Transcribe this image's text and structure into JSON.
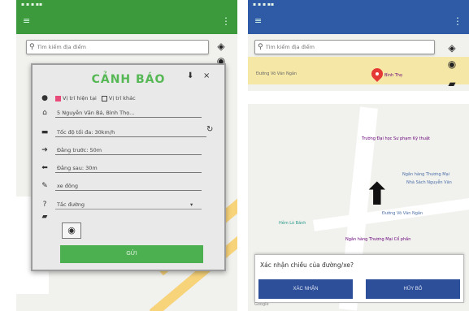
{
  "left_screen": {
    "status_bar": "▪ ▪ ▪  ▪▪",
    "search_placeholder": "Tìm kiếm địa điểm",
    "dialog": {
      "title": "CẢNH BÁO",
      "close_glyph": "×",
      "checkbox_current": "Vị trí hiện tại",
      "checkbox_other": "Vị trí khác",
      "address": "5 Nguyễn Văn Bá, Bình Thọ...",
      "max_speed": "Tốc độ tối đa: 30km/h",
      "before": "Đằng trước: 50m",
      "after": "Đằng sau: 30m",
      "type": "xe đông",
      "category": "Tắc đường",
      "dropdown_glyph": "▾",
      "send_label": "GỬI"
    },
    "icons": {
      "hamburger": "menu-icon",
      "search": "search-icon",
      "layers": "layers-icon"
    },
    "colors": {
      "header": "#3c9a3c",
      "title": "#55b855",
      "send": "#4caf50"
    }
  },
  "right_screen": {
    "status_bar": "▪ ▪ ▪  ▪▪",
    "search_placeholder": "Tìm kiếm địa điểm",
    "map_labels": {
      "road_top": "Đường Võ Văn Ngân",
      "place_top": "Bình Thọ",
      "place_mid": "Trường Đại học Sư phạm Kỹ thuật",
      "place_right": "Ngân hàng Thương Mại",
      "place_right2": "Nhà Sách Nguyễn Văn",
      "place_center": "Hẻm Lò Bánh",
      "road_bottom": "Đường Võ Văn Ngân",
      "place_bottom": "Ngân hàng Thương Mại Cổ phần"
    },
    "confirm": {
      "question": "Xác nhận chiều của đường/xe?",
      "left_button": "XÁC NHẬN",
      "right_button": "HỦY BỎ"
    },
    "attribution": "Google",
    "colors": {
      "header": "#2f5aa6",
      "buttons": "#2d4e98",
      "pin": "#e53935"
    }
  }
}
